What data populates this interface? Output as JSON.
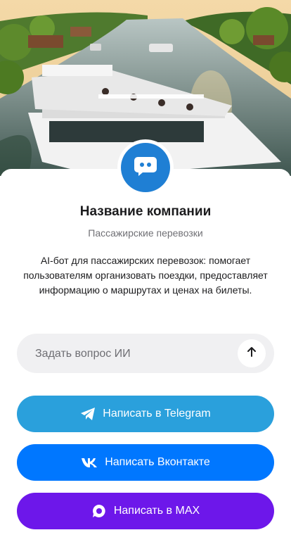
{
  "company": {
    "name": "Название компании",
    "category": "Пассажирские перевозки",
    "description": "AI-бот для пассажирских перевозок: помогает пользователям организовать поездки, предоставляет информацию о маршрутах и ценах на билеты."
  },
  "ask": {
    "placeholder": "Задать вопрос ИИ",
    "value": ""
  },
  "buttons": {
    "telegram": {
      "label": "Написать в Telegram",
      "color": "#2aa0dc"
    },
    "vk": {
      "label": "Написать Вконтакте",
      "color": "#0077ff"
    },
    "max": {
      "label": "Написать в MAX",
      "color": "#6d17ea"
    }
  },
  "colors": {
    "brand": "#1f7fd4"
  },
  "icons": [
    "bot-chat-icon",
    "arrow-up-icon",
    "telegram-icon",
    "vk-icon",
    "max-icon"
  ]
}
